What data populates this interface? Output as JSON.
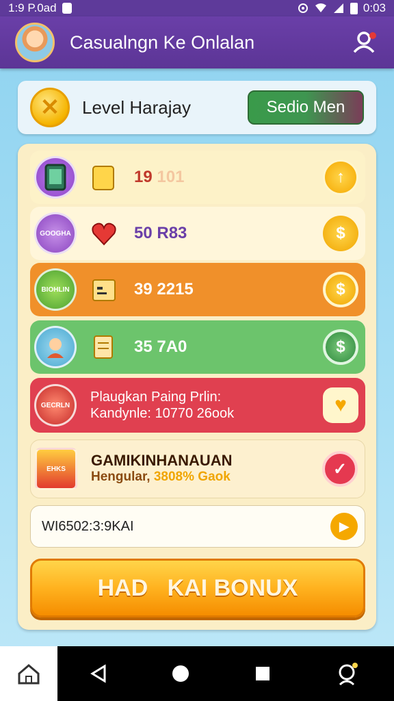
{
  "status_bar": {
    "time_left": "1:9 P.0ad",
    "time_right": "0:03"
  },
  "app_bar": {
    "title": "Casualngn Ke Onlalan"
  },
  "level_card": {
    "label": "Level Harajay",
    "button_label": "Sedio Men"
  },
  "rows": [
    {
      "value": "19",
      "value_suffix": "101",
      "icon_text": ""
    },
    {
      "value": "50 R83",
      "icon_text": "GOOGHA"
    },
    {
      "value": "39 2215",
      "icon_text": "BIOHLIN"
    },
    {
      "value": "35 7A0",
      "icon_text": ""
    }
  ],
  "promo": {
    "line1": "Plaugkan  Paing Prlin:",
    "line2": "Kandynle: 10770 26ook",
    "icon_text": "GECRLN"
  },
  "reward": {
    "title": "GAMIKINHANAUAN",
    "subtitle_prefix": "Hengular,",
    "subtitle_highlight": "3808% Gaok",
    "icon_text": "EHKS"
  },
  "code_field": {
    "value": "WI6502:3:9KAI"
  },
  "bonus_button": {
    "label": "HAD   KAI BONUX"
  },
  "colors": {
    "app_bar": "#5c3596",
    "panel": "#fbeec6",
    "row_orange": "#f0902a",
    "row_green": "#6cc46c",
    "row_red": "#e04050",
    "bonus": "#ffb21f"
  }
}
